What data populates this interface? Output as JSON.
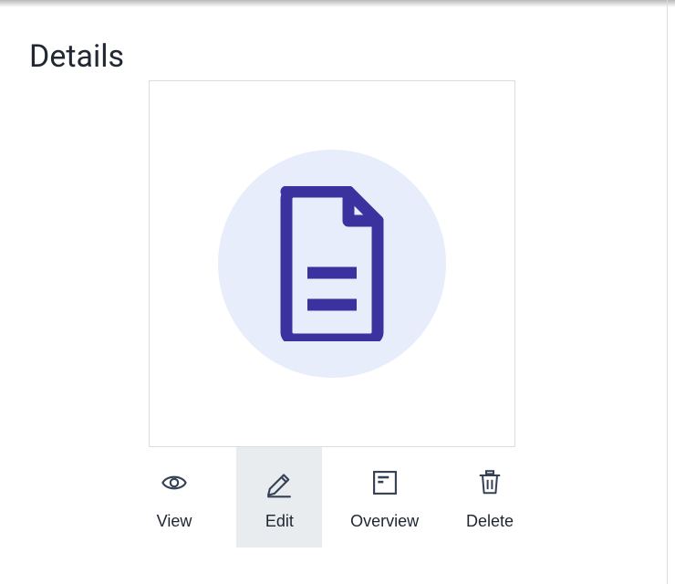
{
  "title": "Details",
  "actions": {
    "view": {
      "label": "View",
      "active": false
    },
    "edit": {
      "label": "Edit",
      "active": true
    },
    "overview": {
      "label": "Overview",
      "active": false
    },
    "delete": {
      "label": "Delete",
      "active": false
    }
  },
  "colors": {
    "accent": "#3b329f",
    "circle_bg": "#e8edfb",
    "icon_stroke": "#344054",
    "active_bg": "#e9ecef"
  }
}
